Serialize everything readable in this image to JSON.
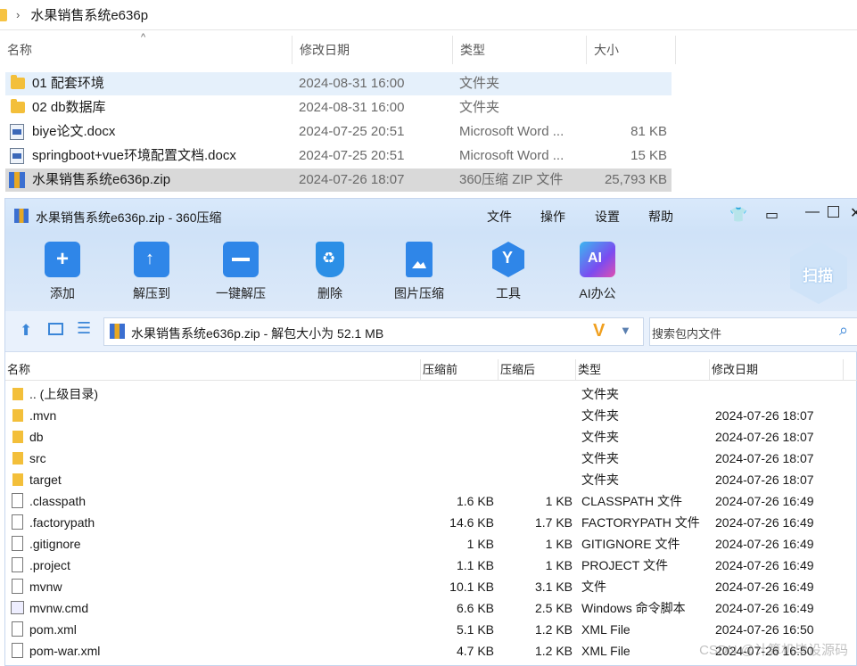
{
  "explorer": {
    "path": "水果销售系统e636p",
    "columns": {
      "name": "名称",
      "date": "修改日期",
      "type": "类型",
      "size": "大小"
    },
    "rows": [
      {
        "name": "01 配套环境",
        "date": "2024-08-31 16:00",
        "type": "文件夹",
        "size": "",
        "icon": "folder-icon"
      },
      {
        "name": "02 db数据库",
        "date": "2024-08-31 16:00",
        "type": "文件夹",
        "size": "",
        "icon": "folder-icon"
      },
      {
        "name": "biye论文.docx",
        "date": "2024-07-25 20:51",
        "type": "Microsoft Word ...",
        "size": "81 KB",
        "icon": "word-doc-icon"
      },
      {
        "name": "springboot+vue环境配置文档.docx",
        "date": "2024-07-25 20:51",
        "type": "Microsoft Word ...",
        "size": "15 KB",
        "icon": "word-doc-icon"
      },
      {
        "name": "水果销售系统e636p.zip",
        "date": "2024-07-26 18:07",
        "type": "360压缩 ZIP 文件",
        "size": "25,793 KB",
        "icon": "zip-archive-icon"
      }
    ]
  },
  "zipwin": {
    "title": "水果销售系统e636p.zip - 360压缩",
    "menu": [
      "文件",
      "操作",
      "设置",
      "帮助"
    ],
    "tools": [
      "添加",
      "解压到",
      "一键解压",
      "删除",
      "图片压缩",
      "工具",
      "AI办公"
    ],
    "scan_label": "扫描",
    "ai_icon_text": "AI",
    "path_text": "水果销售系统e636p.zip - 解包大小为 52.1 MB",
    "search_placeholder": "搜索包内文件",
    "columns": {
      "name": "名称",
      "before": "压缩前",
      "after": "压缩后",
      "type": "类型",
      "date": "修改日期"
    },
    "rows": [
      {
        "name": ".. (上级目录)",
        "before": "",
        "after": "",
        "type": "文件夹",
        "date": "",
        "icon": "folder"
      },
      {
        "name": ".mvn",
        "before": "",
        "after": "",
        "type": "文件夹",
        "date": "2024-07-26 18:07",
        "icon": "folder"
      },
      {
        "name": "db",
        "before": "",
        "after": "",
        "type": "文件夹",
        "date": "2024-07-26 18:07",
        "icon": "folder"
      },
      {
        "name": "src",
        "before": "",
        "after": "",
        "type": "文件夹",
        "date": "2024-07-26 18:07",
        "icon": "folder"
      },
      {
        "name": "target",
        "before": "",
        "after": "",
        "type": "文件夹",
        "date": "2024-07-26 18:07",
        "icon": "folder"
      },
      {
        "name": ".classpath",
        "before": "1.6 KB",
        "after": "1 KB",
        "type": "CLASSPATH 文件",
        "date": "2024-07-26 16:49",
        "icon": "file"
      },
      {
        "name": ".factorypath",
        "before": "14.6 KB",
        "after": "1.7 KB",
        "type": "FACTORYPATH 文件",
        "date": "2024-07-26 16:49",
        "icon": "file"
      },
      {
        "name": ".gitignore",
        "before": "1 KB",
        "after": "1 KB",
        "type": "GITIGNORE 文件",
        "date": "2024-07-26 16:49",
        "icon": "file"
      },
      {
        "name": ".project",
        "before": "1.1 KB",
        "after": "1 KB",
        "type": "PROJECT 文件",
        "date": "2024-07-26 16:49",
        "icon": "file"
      },
      {
        "name": "mvnw",
        "before": "10.1 KB",
        "after": "3.1 KB",
        "type": "文件",
        "date": "2024-07-26 16:49",
        "icon": "file"
      },
      {
        "name": "mvnw.cmd",
        "before": "6.6 KB",
        "after": "2.5 KB",
        "type": "Windows 命令脚本",
        "date": "2024-07-26 16:49",
        "icon": "cmd"
      },
      {
        "name": "pom.xml",
        "before": "5.1 KB",
        "after": "1.2 KB",
        "type": "XML File",
        "date": "2024-07-26 16:50",
        "icon": "file"
      },
      {
        "name": "pom-war.xml",
        "before": "4.7 KB",
        "after": "1.2 KB",
        "type": "XML File",
        "date": "2024-07-26 16:50",
        "icon": "file"
      }
    ]
  },
  "watermark": "CSDN @计算机毕设源码"
}
